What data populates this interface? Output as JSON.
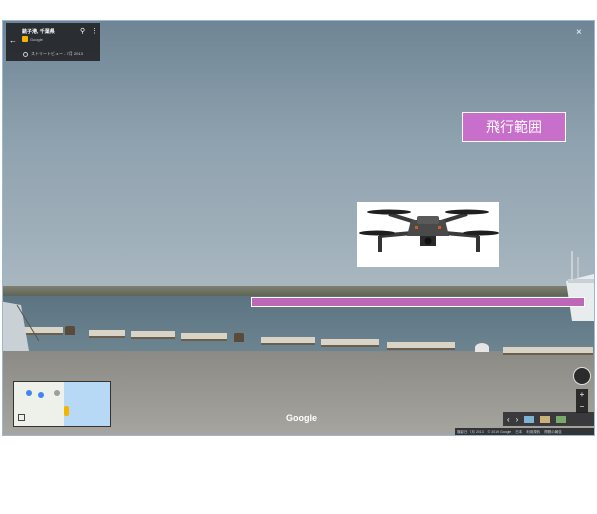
{
  "header": {
    "location_title": "銚子港, 千葉県",
    "provider_label": "Google",
    "timeline_text": "ストリートビュー - 7月 2013"
  },
  "overlay": {
    "range_label": "飛行範囲"
  },
  "map": {
    "watermark": "Google"
  },
  "footer": {
    "capture_date": "撮影日: 7月 2013",
    "copyright": "© 2019 Google",
    "country": "日本",
    "terms": "利用規約",
    "report": "問題の報告"
  },
  "controls": {
    "close": "×",
    "back": "←",
    "zoom_in": "+",
    "zoom_out": "−",
    "prev": "‹",
    "next": "›"
  },
  "colors": {
    "range_fill": "#c86ecb",
    "range_bar": "#bc68b6",
    "panel_bg": "#202124"
  }
}
